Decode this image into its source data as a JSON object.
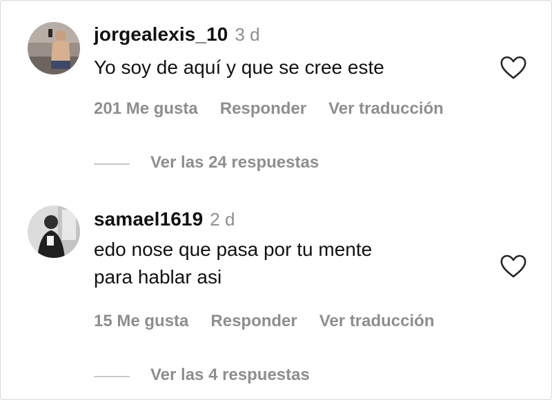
{
  "comments": [
    {
      "username": "jorgealexis_10",
      "time": "3 d",
      "text_lines": [
        "Yo soy de aquí y que se cree este"
      ],
      "likes": "201 Me gusta",
      "reply_label": "Responder",
      "translate_label": "Ver traducción",
      "view_replies": "Ver las 24 respuestas",
      "icons": {
        "like": "heart-outline-icon"
      }
    },
    {
      "username": "samael1619",
      "time": "2 d",
      "text_lines": [
        "edo nose que pasa por tu mente",
        "para hablar asi"
      ],
      "likes": "15 Me gusta",
      "reply_label": "Responder",
      "translate_label": "Ver traducción",
      "view_replies": "Ver las 4 respuestas",
      "icons": {
        "like": "heart-outline-icon"
      }
    }
  ],
  "colors": {
    "text": "#111111",
    "muted": "#8e8e8e",
    "divider": "#c7c7c7"
  }
}
